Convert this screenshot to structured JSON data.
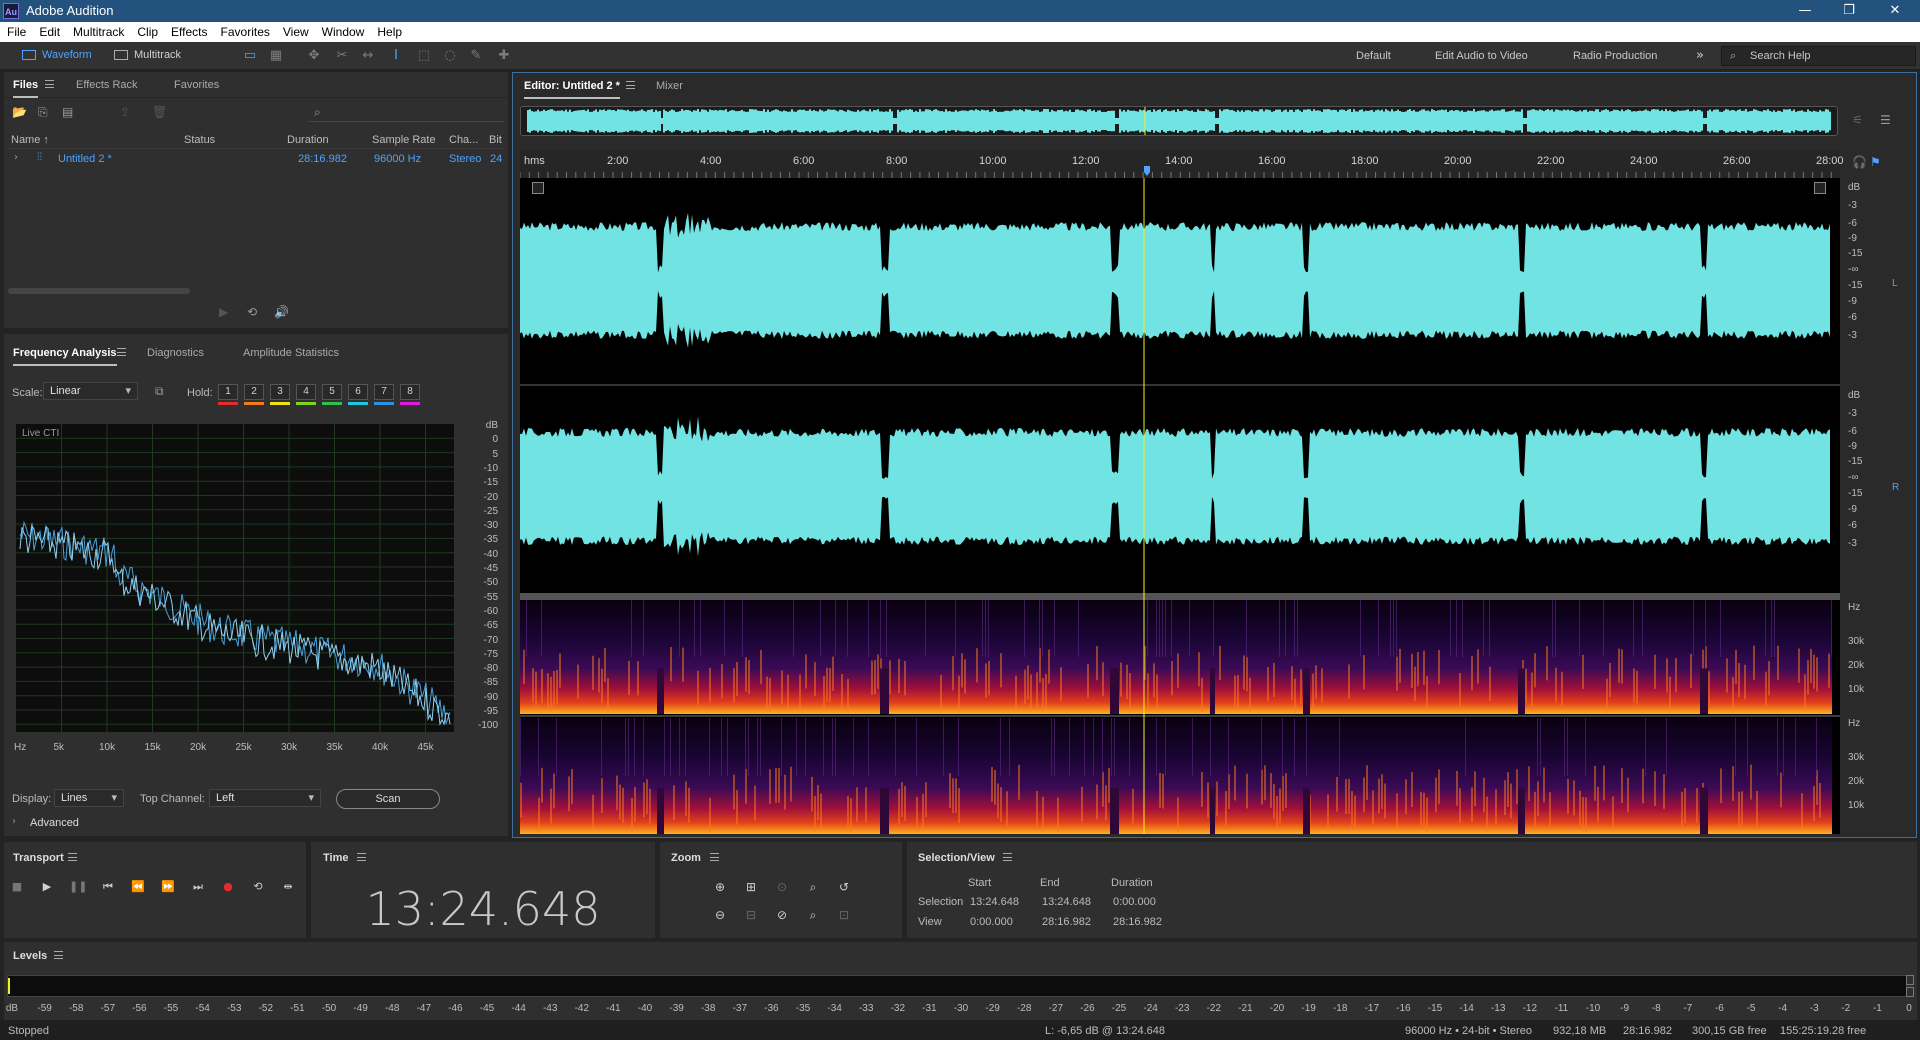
{
  "app": {
    "title": "Adobe Audition",
    "logo": "Au"
  },
  "menu": [
    "File",
    "Edit",
    "Multitrack",
    "Clip",
    "Effects",
    "Favorites",
    "View",
    "Window",
    "Help"
  ],
  "toolbar": {
    "waveform": "Waveform",
    "multitrack": "Multitrack",
    "workspaces": [
      "Default",
      "Edit Audio to Video",
      "Radio Production"
    ],
    "search_placeholder": "Search Help"
  },
  "files": {
    "tabs": [
      "Files",
      "Effects Rack",
      "Favorites"
    ],
    "columns": [
      "Name",
      "Status",
      "Duration",
      "Sample Rate",
      "Cha...",
      "Bit"
    ],
    "row": {
      "name": "Untitled 2 *",
      "duration": "28:16.982",
      "sample_rate": "96000 Hz",
      "channels": "Stereo",
      "bit": "24"
    }
  },
  "freq": {
    "tabs": [
      "Frequency Analysis",
      "Diagnostics",
      "Amplitude Statistics"
    ],
    "scale_label": "Scale:",
    "scale_value": "Linear",
    "hold_label": "Hold:",
    "holds": [
      "1",
      "2",
      "3",
      "4",
      "5",
      "6",
      "7",
      "8"
    ],
    "hold_colors": [
      "#e52b2b",
      "#f07d1a",
      "#f0e21a",
      "#7ed321",
      "#2fbf4a",
      "#1ac8e0",
      "#2f8fe0",
      "#e01ae0"
    ],
    "live": "Live CTI",
    "db_axis": [
      "dB",
      "0",
      "5",
      "-10",
      "-15",
      "-20",
      "-25",
      "-30",
      "-35",
      "-40",
      "-45",
      "-50",
      "-55",
      "-60",
      "-65",
      "-70",
      "-75",
      "-80",
      "-85",
      "-90",
      "-95",
      "-100"
    ],
    "hz_axis": [
      "Hz",
      "5k",
      "10k",
      "15k",
      "20k",
      "25k",
      "30k",
      "35k",
      "40k",
      "45k"
    ],
    "display_label": "Display:",
    "display_value": "Lines",
    "top_channel_label": "Top Channel:",
    "top_channel_value": "Left",
    "scan": "Scan",
    "advanced": "Advanced"
  },
  "editor": {
    "tab": "Editor: Untitled 2 *",
    "mixer": "Mixer",
    "ruler": [
      "hms",
      "2:00",
      "4:00",
      "6:00",
      "8:00",
      "10:00",
      "12:00",
      "14:00",
      "16:00",
      "18:00",
      "20:00",
      "22:00",
      "24:00",
      "26:00",
      "28:00"
    ],
    "db_scale": [
      "dB",
      "-3",
      "-6",
      "-9",
      "-15",
      "-∞",
      "-15",
      "-9",
      "-6",
      "-3"
    ],
    "hz_scale": [
      "Hz",
      "30k",
      "20k",
      "10k"
    ],
    "channel_left": "L",
    "channel_right": "R",
    "wave_color": "#72e3e3",
    "playhead_color": "#f2f21a"
  },
  "transport": {
    "title": "Transport"
  },
  "time": {
    "title": "Time",
    "value": "13:24.648"
  },
  "zoom": {
    "title": "Zoom"
  },
  "selview": {
    "title": "Selection/View",
    "headers": [
      "Start",
      "End",
      "Duration"
    ],
    "selection_label": "Selection",
    "selection": [
      "13:24.648",
      "13:24.648",
      "0:00.000"
    ],
    "view_label": "View",
    "view": [
      "0:00.000",
      "28:16.982",
      "28:16.982"
    ]
  },
  "levels": {
    "title": "Levels",
    "ticks": [
      "dB",
      "-59",
      "-58",
      "-57",
      "-56",
      "-55",
      "-54",
      "-53",
      "-52",
      "-51",
      "-50",
      "-49",
      "-48",
      "-47",
      "-46",
      "-45",
      "-44",
      "-43",
      "-42",
      "-41",
      "-40",
      "-39",
      "-38",
      "-37",
      "-36",
      "-35",
      "-34",
      "-33",
      "-32",
      "-31",
      "-30",
      "-29",
      "-28",
      "-27",
      "-26",
      "-25",
      "-24",
      "-23",
      "-22",
      "-21",
      "-20",
      "-19",
      "-18",
      "-17",
      "-16",
      "-15",
      "-14",
      "-13",
      "-12",
      "-11",
      "-10",
      "-9",
      "-8",
      "-7",
      "-6",
      "-5",
      "-4",
      "-3",
      "-2",
      "-1",
      "0"
    ]
  },
  "status": {
    "state": "Stopped",
    "level": "L: -6,65 dB @ 13:24.648",
    "format": "96000 Hz • 24-bit • Stereo",
    "mem": "932,18 MB",
    "duration": "28:16.982",
    "free": "300,15 GB free",
    "free_time": "155:25:19.28 free"
  }
}
